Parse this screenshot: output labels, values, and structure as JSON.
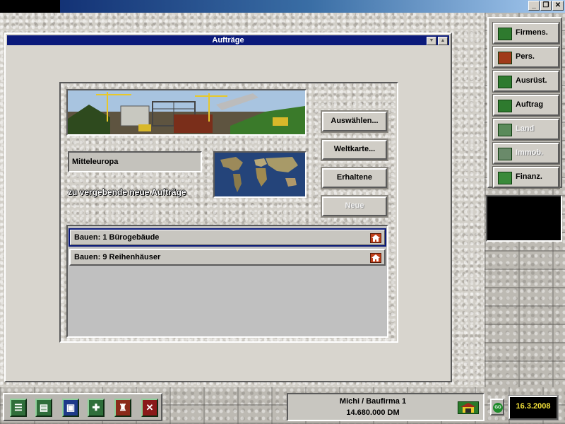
{
  "window": {
    "minimize": "_",
    "restore": "❐",
    "close": "✕"
  },
  "orders_window": {
    "title": "Aufträge",
    "region": "Mitteleuropa",
    "new_orders_label": "zu vergebende neue Aufträge",
    "buttons": {
      "select": "Auswählen...",
      "world_map": "Weltkarte...",
      "received": "Erhaltene",
      "new": "Neue"
    },
    "orders": [
      {
        "label": "Bauen: 1 Bürogebäude",
        "selected": true
      },
      {
        "label": "Bauen: 9 Reihenhäuser",
        "selected": false
      }
    ]
  },
  "side_menu": {
    "items": [
      {
        "label": "Firmens.",
        "icon": "buildings-icon",
        "enabled": true
      },
      {
        "label": "Pers.",
        "icon": "worker-icon",
        "enabled": true
      },
      {
        "label": "Ausrüst.",
        "icon": "crane-icon",
        "enabled": true
      },
      {
        "label": "Auftrag",
        "icon": "contract-icon",
        "enabled": true
      },
      {
        "label": "Land",
        "icon": "land-icon",
        "enabled": false
      },
      {
        "label": "Immob.",
        "icon": "house-icon",
        "enabled": false
      },
      {
        "label": "Finanz.",
        "icon": "money-icon",
        "enabled": true
      }
    ]
  },
  "toolbar": {
    "tools": [
      {
        "icon": "list-icon",
        "glyph": "☰"
      },
      {
        "icon": "document-icon",
        "glyph": "▤"
      },
      {
        "icon": "save-disk-icon",
        "glyph": "▣"
      },
      {
        "icon": "stats-icon",
        "glyph": "✚"
      },
      {
        "icon": "fire-extinguisher-icon",
        "glyph": "♜"
      },
      {
        "icon": "exit-icon",
        "glyph": "✕"
      }
    ]
  },
  "status": {
    "user": "Michi / Baufirma 1",
    "money": "14.680.000 DM",
    "go": "GO",
    "date": "16.3.2008"
  }
}
